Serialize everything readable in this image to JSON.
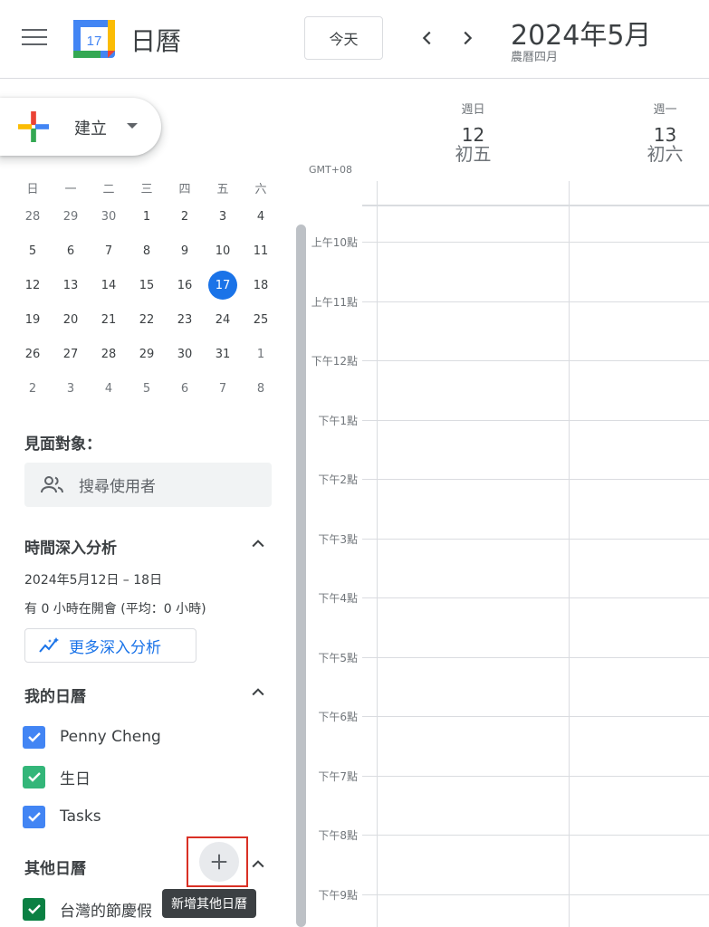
{
  "header": {
    "app_title": "日曆",
    "logo_day": "17",
    "today_label": "今天",
    "month_title": "2024年5月",
    "lunar_month": "農曆四月"
  },
  "create": {
    "label": "建立"
  },
  "mini_calendar": {
    "weekdays": [
      "日",
      "一",
      "二",
      "三",
      "四",
      "五",
      "六"
    ],
    "weeks": [
      [
        {
          "d": "28",
          "o": true
        },
        {
          "d": "29",
          "o": true
        },
        {
          "d": "30",
          "o": true
        },
        {
          "d": "1"
        },
        {
          "d": "2"
        },
        {
          "d": "3"
        },
        {
          "d": "4"
        }
      ],
      [
        {
          "d": "5"
        },
        {
          "d": "6"
        },
        {
          "d": "7"
        },
        {
          "d": "8"
        },
        {
          "d": "9"
        },
        {
          "d": "10"
        },
        {
          "d": "11"
        }
      ],
      [
        {
          "d": "12"
        },
        {
          "d": "13"
        },
        {
          "d": "14"
        },
        {
          "d": "15"
        },
        {
          "d": "16"
        },
        {
          "d": "17",
          "t": true
        },
        {
          "d": "18"
        }
      ],
      [
        {
          "d": "19"
        },
        {
          "d": "20"
        },
        {
          "d": "21"
        },
        {
          "d": "22"
        },
        {
          "d": "23"
        },
        {
          "d": "24"
        },
        {
          "d": "25"
        }
      ],
      [
        {
          "d": "26"
        },
        {
          "d": "27"
        },
        {
          "d": "28"
        },
        {
          "d": "29"
        },
        {
          "d": "30"
        },
        {
          "d": "31"
        },
        {
          "d": "1",
          "o": true
        }
      ],
      [
        {
          "d": "2",
          "o": true
        },
        {
          "d": "3",
          "o": true
        },
        {
          "d": "4",
          "o": true
        },
        {
          "d": "5",
          "o": true
        },
        {
          "d": "6",
          "o": true
        },
        {
          "d": "7",
          "o": true
        },
        {
          "d": "8",
          "o": true
        }
      ]
    ]
  },
  "meet": {
    "title": "見面對象：",
    "search_placeholder": "搜尋使用者"
  },
  "insights": {
    "title": "時間深入分析",
    "date_range": "2024年5月12日 – 18日",
    "meeting_summary": "有 0 小時在開會 (平均：0 小時)",
    "more_label": "更多深入分析"
  },
  "my_calendars": {
    "title": "我的日曆",
    "items": [
      {
        "name": "Penny Cheng",
        "color": "#4285f4"
      },
      {
        "name": "生日",
        "color": "#33b679"
      },
      {
        "name": "Tasks",
        "color": "#4285f4"
      }
    ]
  },
  "other_calendars": {
    "title": "其他日曆",
    "tooltip": "新增其他日曆",
    "items": [
      {
        "name": "台灣的節慶假",
        "color": "#0b8043"
      }
    ]
  },
  "timezone": "GMT+08",
  "days": [
    {
      "dow": "週日",
      "num": "12",
      "lunar": "初五"
    },
    {
      "dow": "週一",
      "num": "13",
      "lunar": "初六"
    }
  ],
  "hours": [
    "上午10點",
    "上午11點",
    "下午12點",
    "下午1點",
    "下午2點",
    "下午3點",
    "下午4點",
    "下午5點",
    "下午6點",
    "下午7點",
    "下午8點",
    "下午9點"
  ]
}
